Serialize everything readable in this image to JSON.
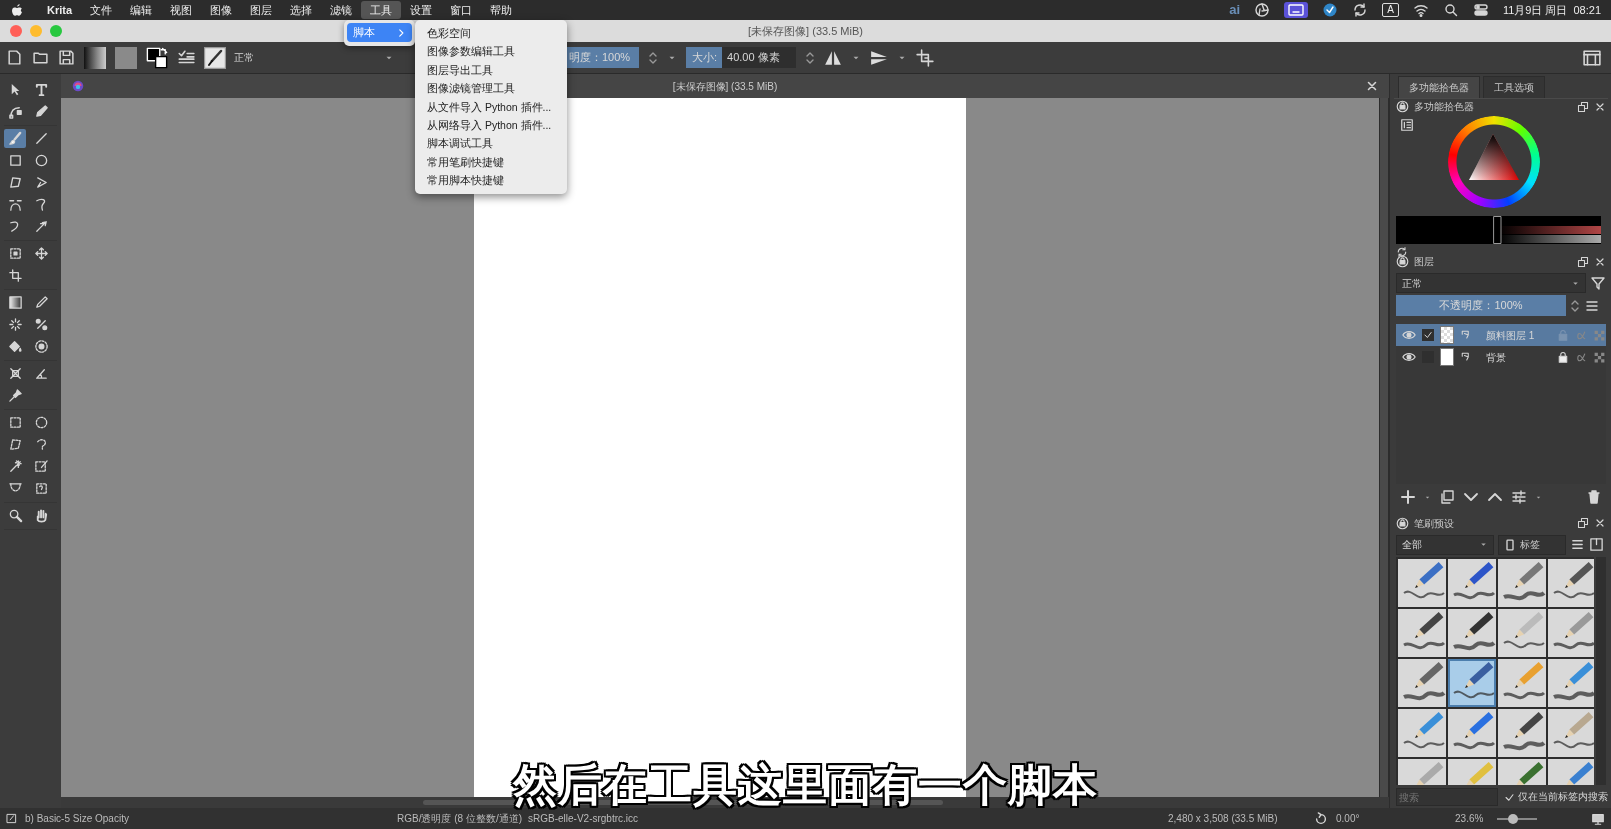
{
  "mac_menubar": {
    "app": "Krita",
    "items": [
      {
        "label": "文件",
        "selected": false
      },
      {
        "label": "编辑",
        "selected": false
      },
      {
        "label": "视图",
        "selected": false
      },
      {
        "label": "图像",
        "selected": false
      },
      {
        "label": "图层",
        "selected": false
      },
      {
        "label": "选择",
        "selected": false
      },
      {
        "label": "滤镜",
        "selected": false
      },
      {
        "label": "工具",
        "selected": true
      },
      {
        "label": "设置",
        "selected": false
      },
      {
        "label": "窗口",
        "selected": false
      },
      {
        "label": "帮助",
        "selected": false
      }
    ],
    "status": {
      "ai": "ai",
      "input_source": "A",
      "date": "11月9日 周日",
      "time": "08:21"
    }
  },
  "window": {
    "title": "[未保存图像] (33.5 MiB)"
  },
  "menu": {
    "items": [
      {
        "label": "脚本",
        "selected": true
      }
    ],
    "submenu": [
      "色彩空间",
      "图像参数编辑工具",
      "图层导出工具",
      "图像滤镜管理工具",
      "从文件导入 Python 插件...",
      "从网络导入 Python 插件...",
      "脚本调试工具",
      "常用笔刷快捷键",
      "常用脚本快捷键"
    ]
  },
  "toolbar": {
    "blend_mode": "正常",
    "opacity": {
      "text": "明度：100%",
      "level": 1
    },
    "size": {
      "label": "大小:",
      "value": "40.00 像素",
      "level": 0.33
    }
  },
  "toolbox": [
    [
      {
        "selected": false
      },
      {
        "selected": false
      },
      {
        "selected": false
      },
      {
        "selected": false
      }
    ],
    [
      {
        "selected": true
      },
      {
        "selected": false
      },
      {
        "selected": false
      },
      {
        "selected": false
      },
      {
        "selected": false
      },
      {
        "selected": false
      },
      {
        "selected": false
      },
      {
        "selected": false
      },
      {
        "selected": false
      },
      {
        "selected": false
      }
    ],
    [
      {
        "selected": false
      },
      {
        "selected": false
      },
      {
        "selected": false
      }
    ],
    [
      {
        "selected": false
      },
      {
        "selected": false
      },
      {
        "selected": false
      },
      {
        "selected": false
      },
      {
        "selected": false
      },
      {
        "selected": false
      }
    ],
    [
      {
        "selected": false
      },
      {
        "selected": false
      },
      {
        "selected": false
      }
    ],
    [
      {
        "selected": false
      },
      {
        "selected": false
      },
      {
        "selected": false
      },
      {
        "selected": false
      },
      {
        "selected": false
      },
      {
        "selected": false
      },
      {
        "selected": false
      },
      {
        "selected": false
      }
    ],
    [
      {
        "selected": false
      },
      {
        "selected": false
      }
    ]
  ],
  "document_tab": {
    "title": "[未保存图像] (33.5 MiB)"
  },
  "subtitle": "然后在工具这里面有一个脚本",
  "dock": {
    "tabs": [
      {
        "label": "多功能拾色器",
        "selected": true
      },
      {
        "label": "工具选项",
        "selected": false
      }
    ],
    "color_panel": {
      "title": "多功能拾色器"
    },
    "layers_panel": {
      "title": "图层",
      "blend_mode": "正常",
      "opacity": {
        "text": "不透明度：100%",
        "level": 1
      },
      "layers": [
        {
          "name": "颜料图层 1",
          "selected": true,
          "visible": true,
          "checked": true,
          "locked": false,
          "kind": "paint"
        },
        {
          "name": "背景",
          "selected": false,
          "visible": true,
          "checked": false,
          "locked": true,
          "kind": "background"
        }
      ]
    },
    "brush_panel": {
      "title": "笔刷预设",
      "tag_filter": "全部",
      "tag_button": "标签",
      "presets": [
        {
          "selected": false
        },
        {
          "selected": false
        },
        {
          "selected": false
        },
        {
          "selected": false
        },
        {
          "selected": false
        },
        {
          "selected": false
        },
        {
          "selected": false
        },
        {
          "selected": false
        },
        {
          "selected": false
        },
        {
          "selected": true
        },
        {
          "selected": false
        },
        {
          "selected": false
        },
        {
          "selected": false
        },
        {
          "selected": false
        },
        {
          "selected": false
        },
        {
          "selected": false
        },
        {
          "selected": false
        },
        {
          "selected": false
        },
        {
          "selected": false
        },
        {
          "selected": false
        }
      ],
      "search": {
        "placeholder": "搜索"
      },
      "search_in_tag": {
        "label": "仅在当前标签内搜索",
        "checked": true
      }
    }
  },
  "status_bar": {
    "brush": "b) Basic-5 Size Opacity",
    "color_space": "RGB/透明度 (8 位整数/通道)",
    "profile": "sRGB-elle-V2-srgbtrc.icc",
    "dimensions": "2,480 x 3,508 (33.5 MiB)",
    "rotation": "0.00°",
    "zoom": "23.6%",
    "zoom_slider": {
      "level": 0.4
    }
  }
}
